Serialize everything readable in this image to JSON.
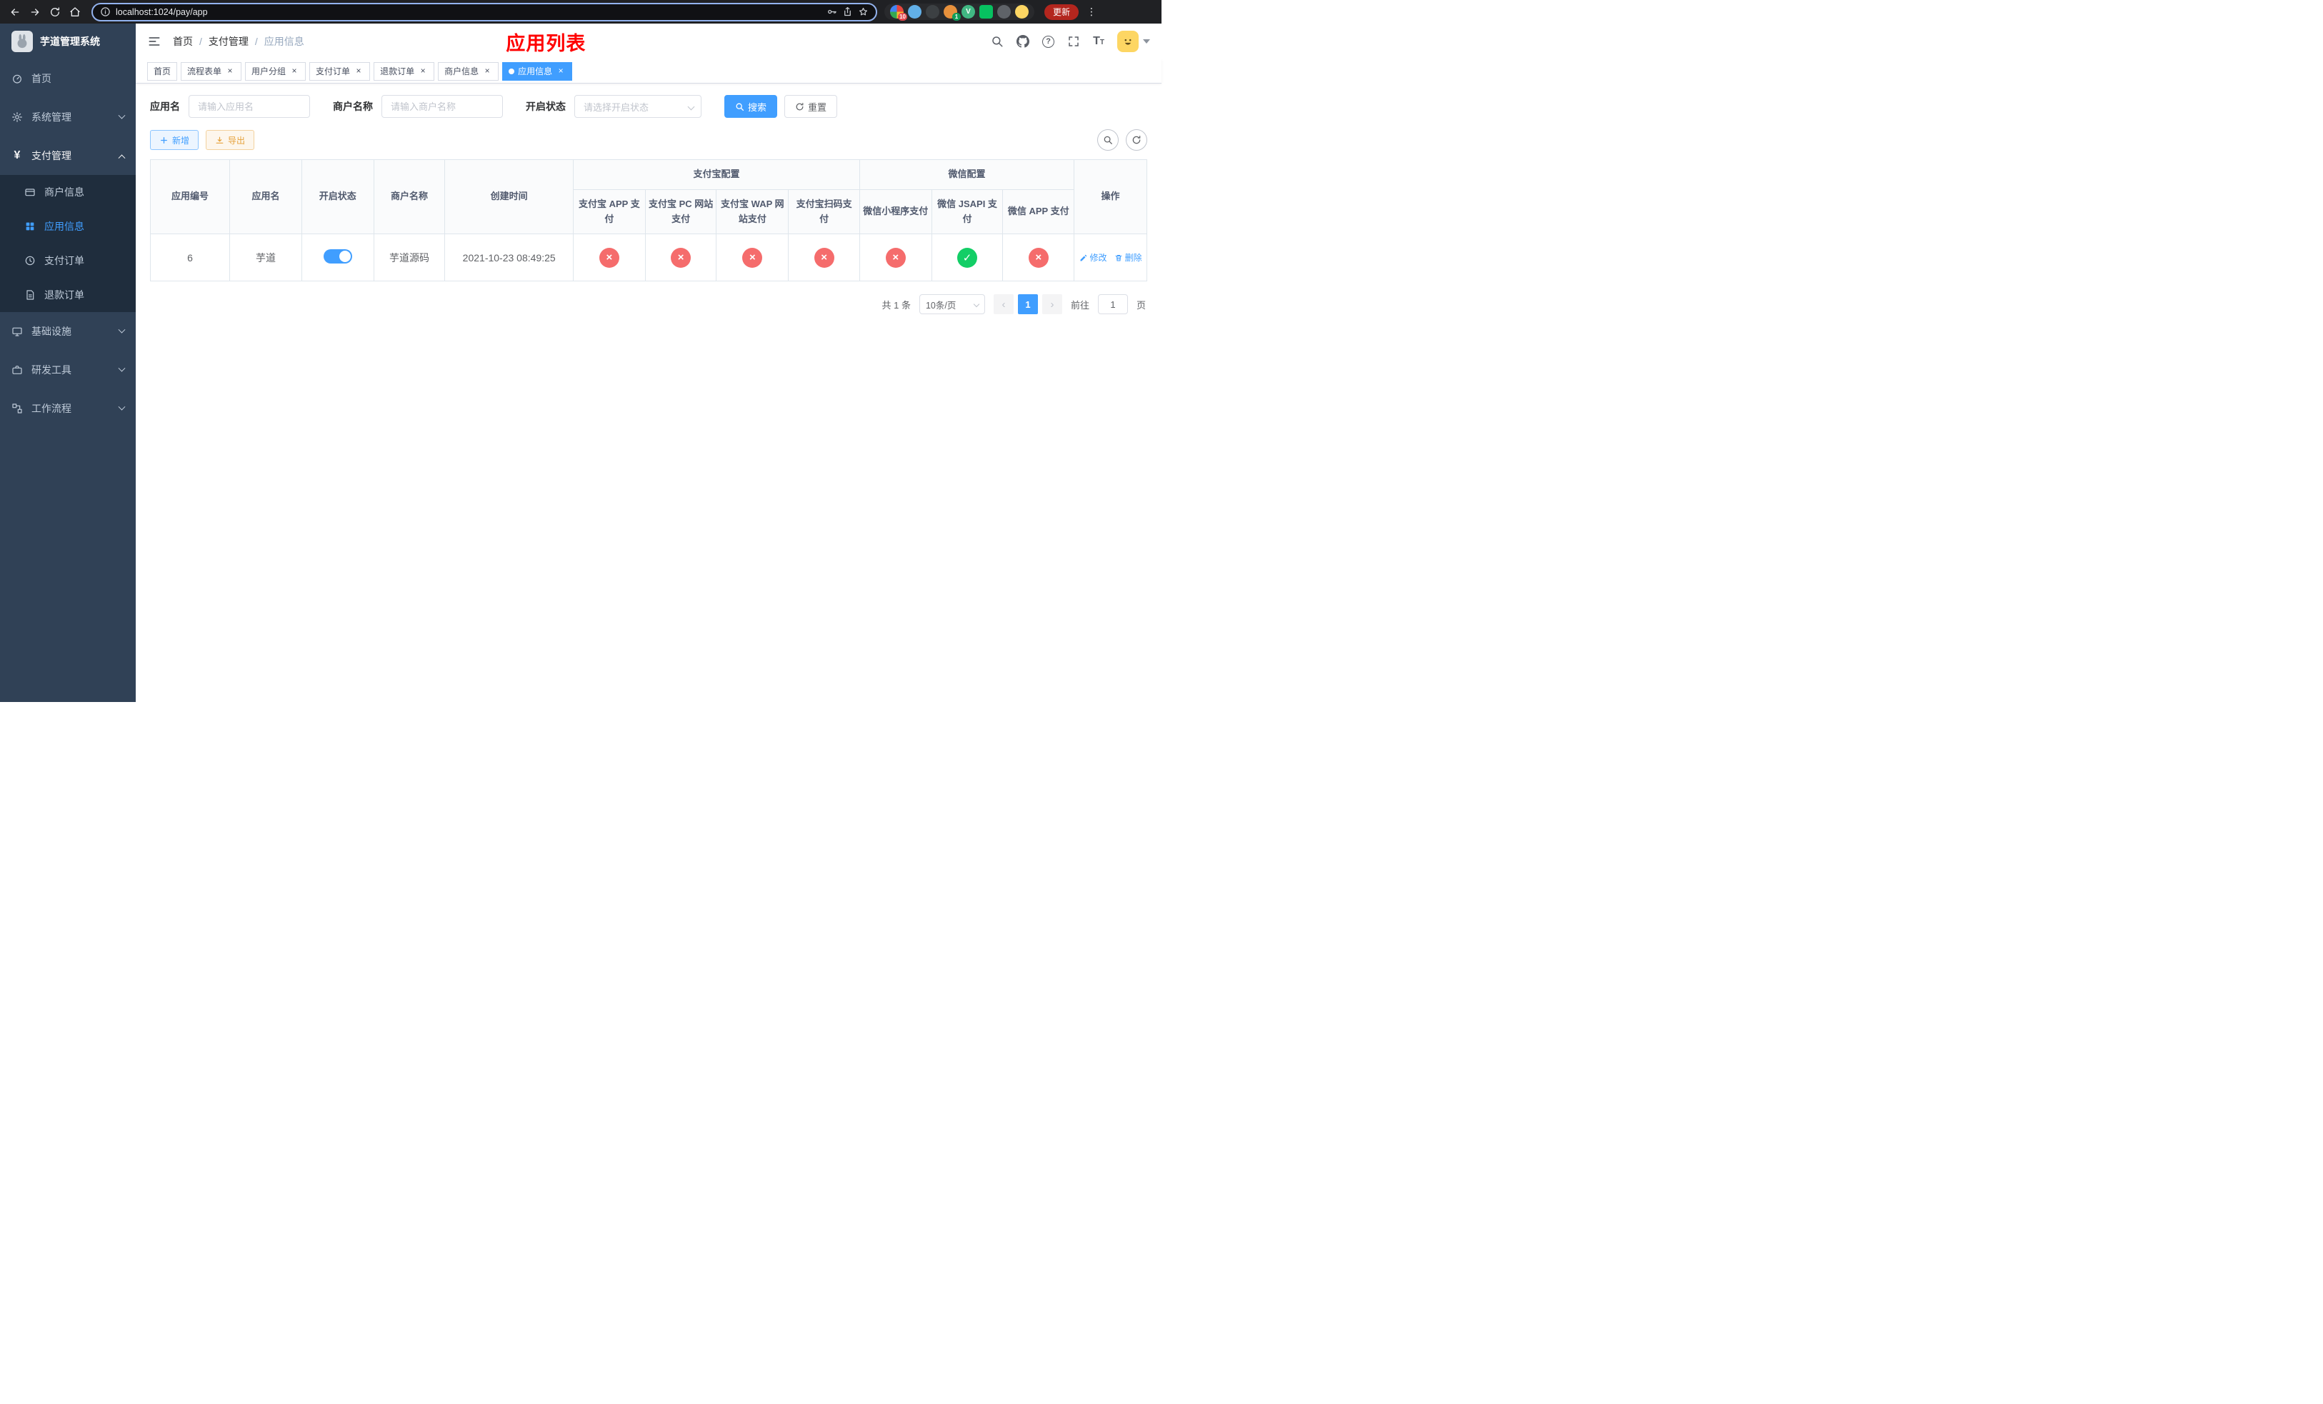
{
  "browser": {
    "url": "localhost:1024/pay/app",
    "update_label": "更新",
    "ext_badge_1": "10",
    "ext_badge_2": "1"
  },
  "glyphs": {
    "close": "×",
    "dots": "⋮",
    "prev": "‹",
    "next": "›"
  },
  "sidebar": {
    "title": "芋道管理系统",
    "home": "首页",
    "system": "系统管理",
    "pay": "支付管理",
    "merchant_info": "商户信息",
    "app_info": "应用信息",
    "pay_order": "支付订单",
    "refund_order": "退款订单",
    "infra": "基础设施",
    "dev_tools": "研发工具",
    "workflow": "工作流程"
  },
  "header": {
    "crumb1": "首页",
    "crumb2": "支付管理",
    "crumb3": "应用信息",
    "title": "应用列表"
  },
  "tabs": [
    {
      "label": "首页",
      "closable": false,
      "active": false
    },
    {
      "label": "流程表单",
      "closable": true,
      "active": false
    },
    {
      "label": "用户分组",
      "closable": true,
      "active": false
    },
    {
      "label": "支付订单",
      "closable": true,
      "active": false
    },
    {
      "label": "退款订单",
      "closable": true,
      "active": false
    },
    {
      "label": "商户信息",
      "closable": true,
      "active": false
    },
    {
      "label": "应用信息",
      "closable": true,
      "active": true
    }
  ],
  "filters": {
    "app_name_label": "应用名",
    "app_name_placeholder": "请输入应用名",
    "merchant_label": "商户名称",
    "merchant_placeholder": "请输入商户名称",
    "status_label": "开启状态",
    "status_placeholder": "请选择开启状态",
    "search_button": "搜索",
    "reset_button": "重置"
  },
  "toolbar": {
    "add_button": "新增",
    "export_button": "导出"
  },
  "table": {
    "col_id": "应用编号",
    "col_name": "应用名",
    "col_status": "开启状态",
    "col_merchant": "商户名称",
    "col_created": "创建时间",
    "group_alipay": "支付宝配置",
    "group_wechat": "微信配置",
    "col_alipay_app": "支付宝 APP 支付",
    "col_alipay_pc": "支付宝 PC 网站支付",
    "col_alipay_wap": "支付宝 WAP 网站支付",
    "col_alipay_qr": "支付宝扫码支付",
    "col_wx_lite": "微信小程序支付",
    "col_wx_jsapi": "微信 JSAPI 支付",
    "col_wx_app": "微信 APP 支付",
    "col_ops": "操作",
    "glyphs": {
      "ok": "✓",
      "fail": "×"
    },
    "row": {
      "id": "6",
      "name": "芋道",
      "status_on": true,
      "merchant": "芋道源码",
      "created": "2021-10-23 08:49:25",
      "channels": {
        "alipay_app": false,
        "alipay_pc": false,
        "alipay_wap": false,
        "alipay_qr": false,
        "wx_lite": false,
        "wx_jsapi": true,
        "wx_app": false
      },
      "edit_label": "修改",
      "delete_label": "删除"
    }
  },
  "pagination": {
    "total_text": "共 1 条",
    "page_size": "10条/页",
    "current_page": "1",
    "goto_label": "前往",
    "goto_value": "1",
    "page_suffix": "页"
  },
  "colors": {
    "primary": "#409eff",
    "danger": "#f56c6c",
    "success": "#13ce66",
    "warning": "#e6a23c",
    "title_red": "#ff0000",
    "sidebar_bg": "#304156",
    "submenu_bg": "#1f2d3d"
  }
}
